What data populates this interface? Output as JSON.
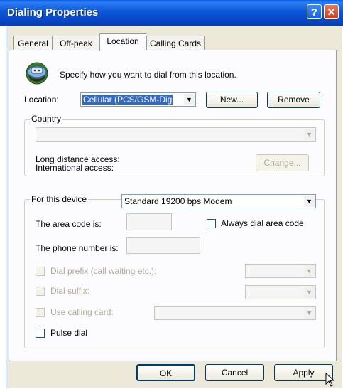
{
  "window": {
    "title": "Dialing Properties",
    "help": "?",
    "close": "✕"
  },
  "tabs": [
    {
      "label": "General"
    },
    {
      "label": "Off-peak"
    },
    {
      "label": "Location"
    },
    {
      "label": "Calling Cards"
    }
  ],
  "location": {
    "intro": "Specify how you want to dial from this location.",
    "label": "Location:",
    "value": "Cellular (PCS/GSM-Dig",
    "new_button": "New...",
    "remove_button": "Remove"
  },
  "country": {
    "legend": "Country",
    "value": "",
    "long_distance_label": "Long distance access:",
    "international_label": "International access:",
    "change_button": "Change..."
  },
  "device": {
    "legend": "For this device",
    "value": "Standard 19200 bps Modem",
    "area_code_label": "The area code is:",
    "area_code_value": "",
    "always_dial_label": "Always dial area code",
    "always_dial_checked": false,
    "phone_label": "The phone number is:",
    "phone_value": "",
    "dial_prefix_label": "Dial prefix (call waiting etc.):",
    "dial_suffix_label": "Dial suffix:",
    "use_card_label": "Use calling card:",
    "pulse_label": "Pulse dial",
    "pulse_checked": false
  },
  "buttons": {
    "ok": "OK",
    "cancel": "Cancel",
    "apply": "Apply"
  },
  "colors": {
    "titlebar": "#0a5fe8",
    "dialog": "#ece9d8",
    "panel": "#fcfcfe",
    "selection": "#316ac5"
  }
}
